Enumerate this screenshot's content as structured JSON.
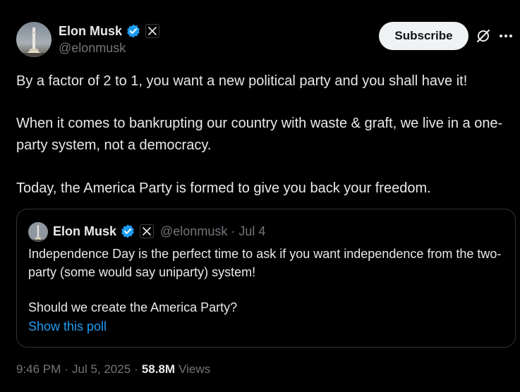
{
  "author": {
    "display_name": "Elon Musk",
    "handle": "@elonmusk",
    "verified_color": "#1d9bf0"
  },
  "actions": {
    "subscribe_label": "Subscribe",
    "grok_icon": "grok-icon",
    "more_icon": "more-icon"
  },
  "tweet": {
    "paragraph_1": "By a factor of 2 to 1, you want a new political party and you shall have it!",
    "paragraph_2": "When it comes to bankrupting our country with waste & graft, we live in a one-party system, not a democracy.",
    "paragraph_3": "Today, the America Party is formed to give you back your freedom."
  },
  "quote": {
    "display_name": "Elon Musk",
    "handle": "@elonmusk",
    "separator": "·",
    "date": "Jul 4",
    "text_1": "Independence Day is the perfect time to ask if you want independence from the two-party (some would say uniparty) system!",
    "text_2": "Should we create the America Party?",
    "poll_link": "Show this poll"
  },
  "meta": {
    "time": "9:46 PM",
    "sep1": "·",
    "date": "Jul 5, 2025",
    "sep2": "·",
    "views_count": "58.8M",
    "views_label": "Views"
  },
  "colors": {
    "background": "#000000",
    "text": "#e7e9ea",
    "secondary": "#71767b",
    "accent": "#1d9bf0",
    "border": "#2f3336"
  }
}
